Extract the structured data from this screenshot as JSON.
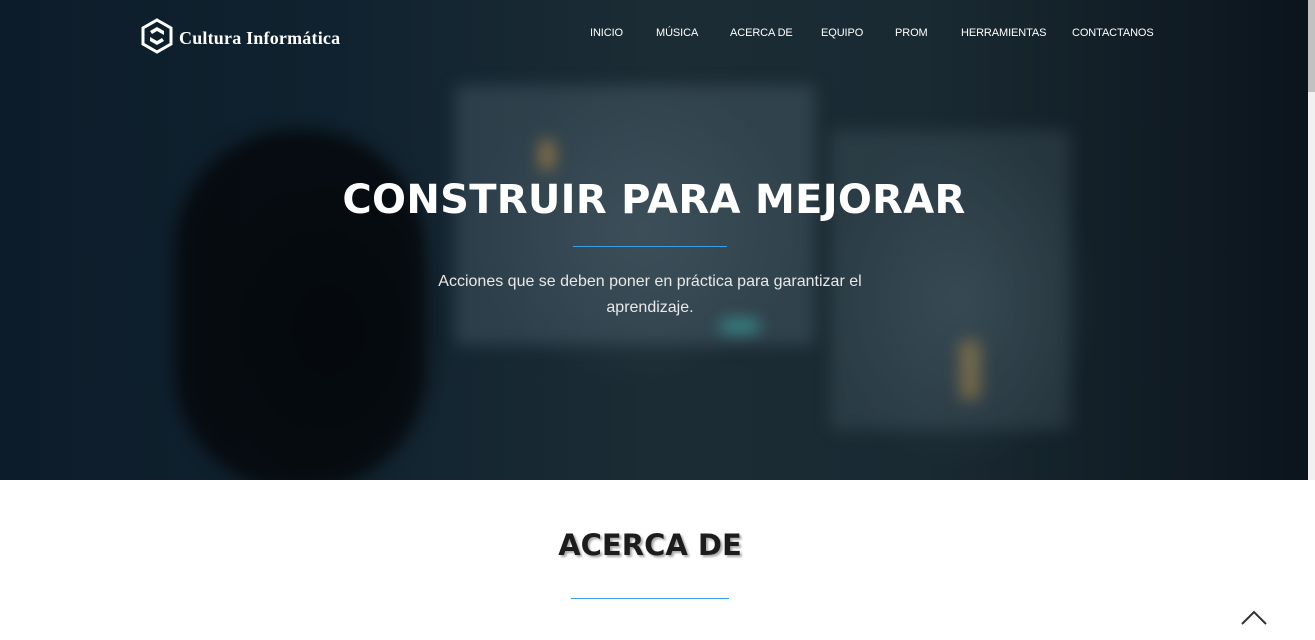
{
  "brand": {
    "name": "Cultura Informática",
    "icon": "hexagon-logo-icon"
  },
  "nav": {
    "items": [
      {
        "label": "INICIO"
      },
      {
        "label": "MÚSICA"
      },
      {
        "label": "ACERCA DE"
      },
      {
        "label": "EQUIPO"
      },
      {
        "label": "PROM"
      },
      {
        "label": "HERRAMIENTAS"
      },
      {
        "label": "CONTACTANOS"
      }
    ]
  },
  "hero": {
    "title": "CONSTRUIR PARA MEJORAR",
    "subtitle": "Acciones que se deben poner en práctica para garantizar el aprendizaje."
  },
  "about": {
    "title": "ACERCA DE"
  },
  "scroll_top": {
    "icon": "chevron-up-icon"
  },
  "colors": {
    "accent": "#3aa0e6",
    "hero_bg": "#10222f",
    "heading": "#1c1c1c"
  }
}
